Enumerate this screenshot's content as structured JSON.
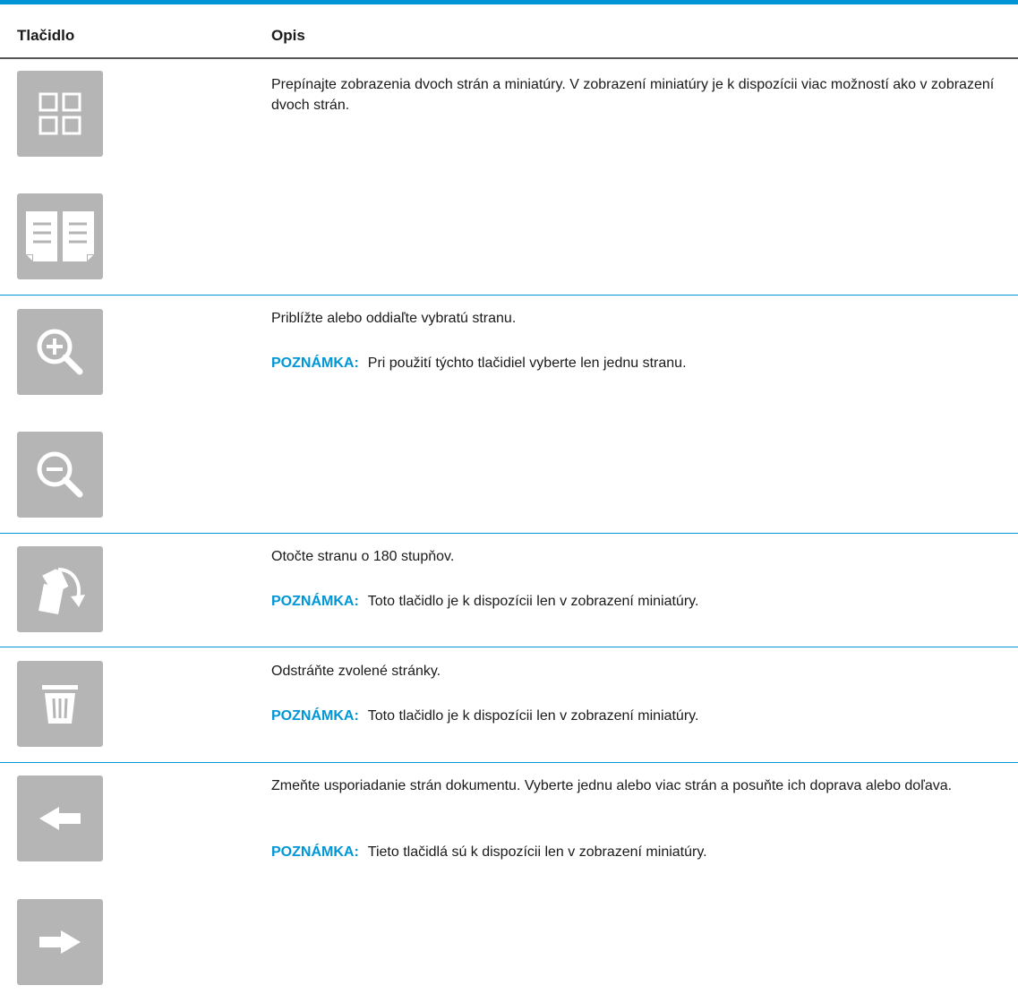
{
  "colors": {
    "accent": "#0096d6",
    "button_bg": "#b5b5b5",
    "icon": "#ffffff"
  },
  "table": {
    "headers": {
      "button": "Tlačidlo",
      "description": "Opis"
    },
    "rows": [
      {
        "icons": [
          "thumbnail-grid-icon",
          "two-page-view-icon"
        ],
        "description": "Prepínajte zobrazenia dvoch strán a miniatúry. V zobrazení miniatúry je k dispozícii viac možností ako v zobrazení dvoch strán."
      },
      {
        "icons": [
          "zoom-in-icon",
          "zoom-out-icon"
        ],
        "description": "Priblížte alebo oddiaľte vybratú stranu.",
        "note_label": "POZNÁMKA:",
        "note_text": "Pri použití týchto tlačidiel vyberte len jednu stranu."
      },
      {
        "icons": [
          "rotate-page-icon"
        ],
        "description": "Otočte stranu o 180 stupňov.",
        "note_label": "POZNÁMKA:",
        "note_text": "Toto tlačidlo je k dispozícii len v zobrazení miniatúry."
      },
      {
        "icons": [
          "trash-icon"
        ],
        "description": "Odstráňte zvolené stránky.",
        "note_label": "POZNÁMKA:",
        "note_text": "Toto tlačidlo je k dispozícii len v zobrazení miniatúry."
      },
      {
        "icons": [
          "arrow-left-icon",
          "arrow-right-icon"
        ],
        "description": "Zmeňte usporiadanie strán dokumentu. Vyberte jednu alebo viac strán a posuňte ich doprava alebo doľava.",
        "note_label": "POZNÁMKA:",
        "note_text": "Tieto tlačidlá sú k dispozícii len v zobrazení miniatúry."
      }
    ]
  }
}
